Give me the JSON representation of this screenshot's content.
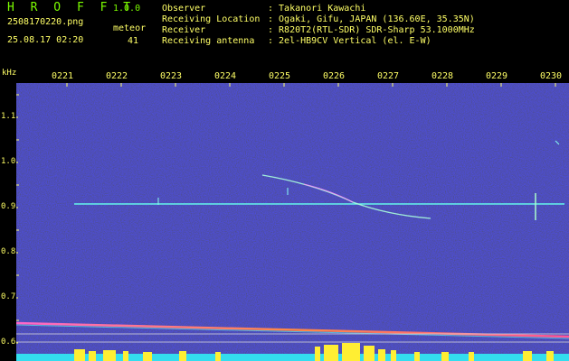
{
  "header": {
    "app_title": "H R O F F T",
    "version": "1.0.0",
    "filename": "2508170220.png",
    "meteor_label": "meteor",
    "datetime": "25.08.17 02:20",
    "meteor_count": "41"
  },
  "info": [
    {
      "label": "Observer",
      "value": ": Takanori Kawachi"
    },
    {
      "label": "Receiving Location",
      "value": ": Ogaki, Gifu, JAPAN (136.60E, 35.35N)"
    },
    {
      "label": "Receiver",
      "value": ": R820T2(RTL-SDR) SDR-Sharp 53.1000MHz"
    },
    {
      "label": "Receiving antenna",
      "value": ": 2el-HB9CV Vertical (el. E-W)"
    }
  ],
  "axis": {
    "y_unit": "kHz",
    "time_ticks": [
      "0221",
      "0222",
      "0223",
      "0224",
      "0225",
      "0226",
      "0227",
      "0228",
      "0229",
      "0230"
    ],
    "freq_ticks": [
      "1.1",
      "1.0",
      "0.9",
      "0.8",
      "0.7",
      "0.6"
    ]
  },
  "colors": {
    "header_green": "#7CFC00",
    "label_yellow": "#ffff66",
    "signal_cyan": "#66ffee",
    "background_noise": "#14143c"
  }
}
